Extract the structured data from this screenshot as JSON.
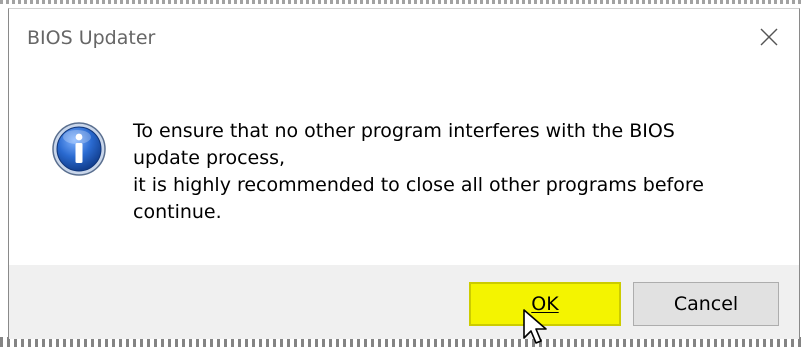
{
  "window": {
    "title": "BIOS Updater",
    "close_icon": "close-icon"
  },
  "dialog": {
    "icon": "info-icon",
    "message": "To ensure that no other program interferes with the BIOS\nupdate process,\nit is highly recommended to close all other programs before\ncontinue."
  },
  "buttons": {
    "ok_label": "OK",
    "cancel_label": "Cancel"
  },
  "colors": {
    "ok_highlight": "#f4f400",
    "icon_blue": "#1e5bb8",
    "footer_bg": "#f0f0f0"
  },
  "cursor": {
    "icon": "mouse-pointer-icon"
  }
}
